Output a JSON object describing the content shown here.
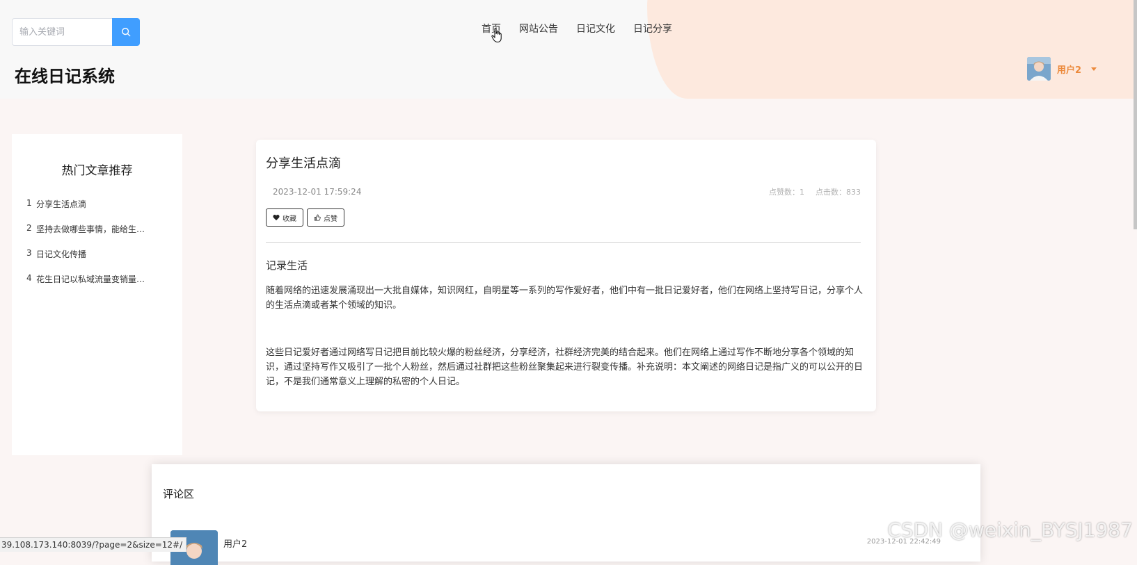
{
  "header": {
    "search_placeholder": "输入关键词",
    "site_title": "在线日记系统",
    "nav_items": [
      "首页",
      "网站公告",
      "日记文化",
      "日记分享"
    ],
    "user_name": "用户2"
  },
  "sidebar": {
    "title": "热门文章推荐",
    "items": [
      {
        "rank": "1",
        "title": "分享生活点滴"
      },
      {
        "rank": "2",
        "title": "坚持去做哪些事情，能给生活带来改变"
      },
      {
        "rank": "3",
        "title": "日记文化传播"
      },
      {
        "rank": "4",
        "title": "花生日记以私域流量变销量的模式"
      }
    ]
  },
  "article": {
    "title": "分享生活点滴",
    "date": "2023-12-01 17:59:24",
    "likes_label": "点赞数：1",
    "clicks_label": "点击数：833",
    "favorite_label": "收藏",
    "like_label": "点赞",
    "subtitle": "记录生活",
    "paragraphs": [
      "随着网络的迅速发展涌现出一大批自媒体，知识网红，自明星等一系列的写作爱好者，他们中有一批日记爱好者，他们在网络上坚持写日记，分享个人的生活点滴或者某个领域的知识。",
      "这些日记爱好者通过网络写日记把目前比较火爆的粉丝经济，分享经济，社群经济完美的结合起来。他们在网络上通过写作不断地分享各个领域的知识，通过坚持写作又吸引了一批个人粉丝，然后通过社群把这些粉丝聚集起来进行裂变传播。补充说明：本文阐述的网络日记是指广义的可以公开的日记，不是我们通常意义上理解的私密的个人日记。"
    ]
  },
  "comments": {
    "heading": "评论区",
    "items": [
      {
        "user": "用户2",
        "time": "2023-12-01 22:42:49"
      }
    ]
  },
  "status_bar": {
    "url": "39.108.173.140:8039/?page=2&size=12#/"
  },
  "watermark": "CSDN @weixin_BYSJ1987",
  "colors": {
    "accent": "#409eff",
    "user_name": "#ec8a3c",
    "header_blob": "#fde9de",
    "page_bg": "#fbf5f4"
  }
}
